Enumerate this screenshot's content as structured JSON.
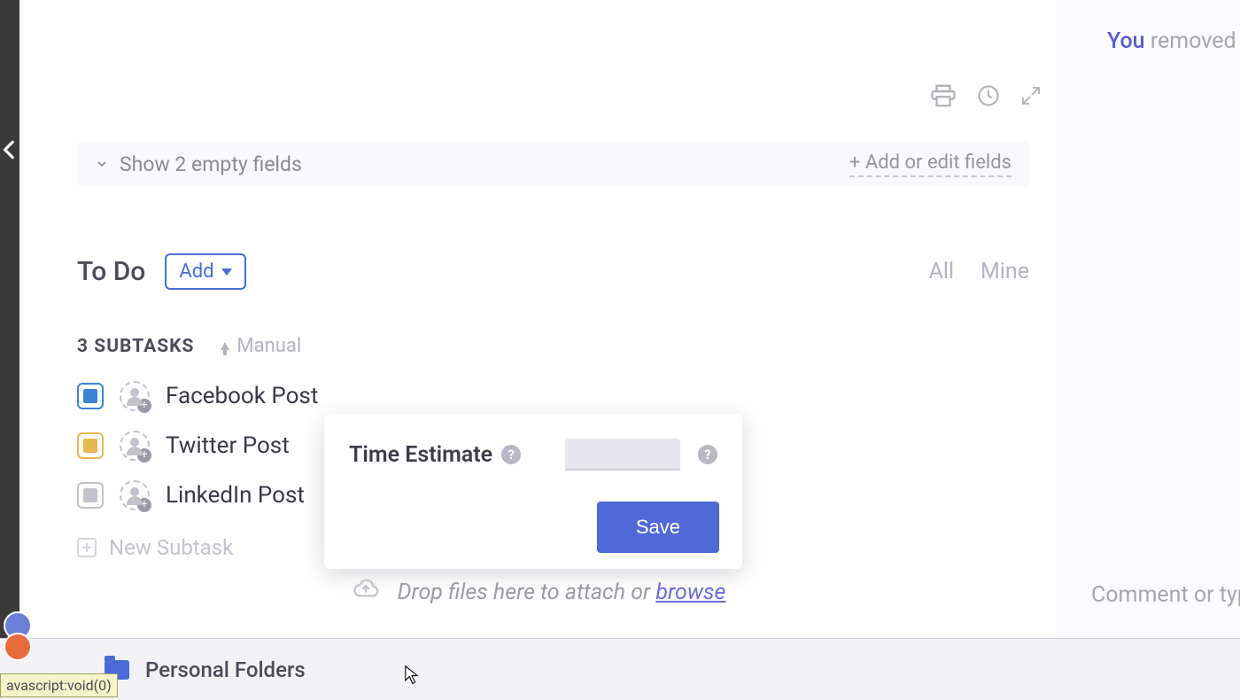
{
  "header": {
    "empty_fields_toggle": "Show 2 empty fields",
    "add_edit_fields": "+ Add or edit fields"
  },
  "todo": {
    "title": "To Do",
    "add_label": "Add",
    "filter_all": "All",
    "filter_mine": "Mine",
    "subtasks_count": "3 SUBTASKS",
    "sort_label": "Manual"
  },
  "subtasks": [
    {
      "title": "Facebook Post",
      "status": "blue"
    },
    {
      "title": "Twitter Post",
      "status": "yellow"
    },
    {
      "title": "LinkedIn Post",
      "status": "gray"
    }
  ],
  "new_subtask_label": "New Subtask",
  "popover": {
    "label": "Time Estimate",
    "input_value": "",
    "input_placeholder": "",
    "save_label": "Save"
  },
  "dropzone": {
    "text": "Drop files here to attach or ",
    "browse": "browse"
  },
  "activity": {
    "you": "You",
    "rest": " removed th"
  },
  "comment_placeholder": "Comment or typ",
  "bottom": {
    "folder_label": "Personal Folders"
  },
  "status_tip": "avascript:void(0)",
  "colors": {
    "accent": "#4a6bd8",
    "save": "#5068d8"
  }
}
